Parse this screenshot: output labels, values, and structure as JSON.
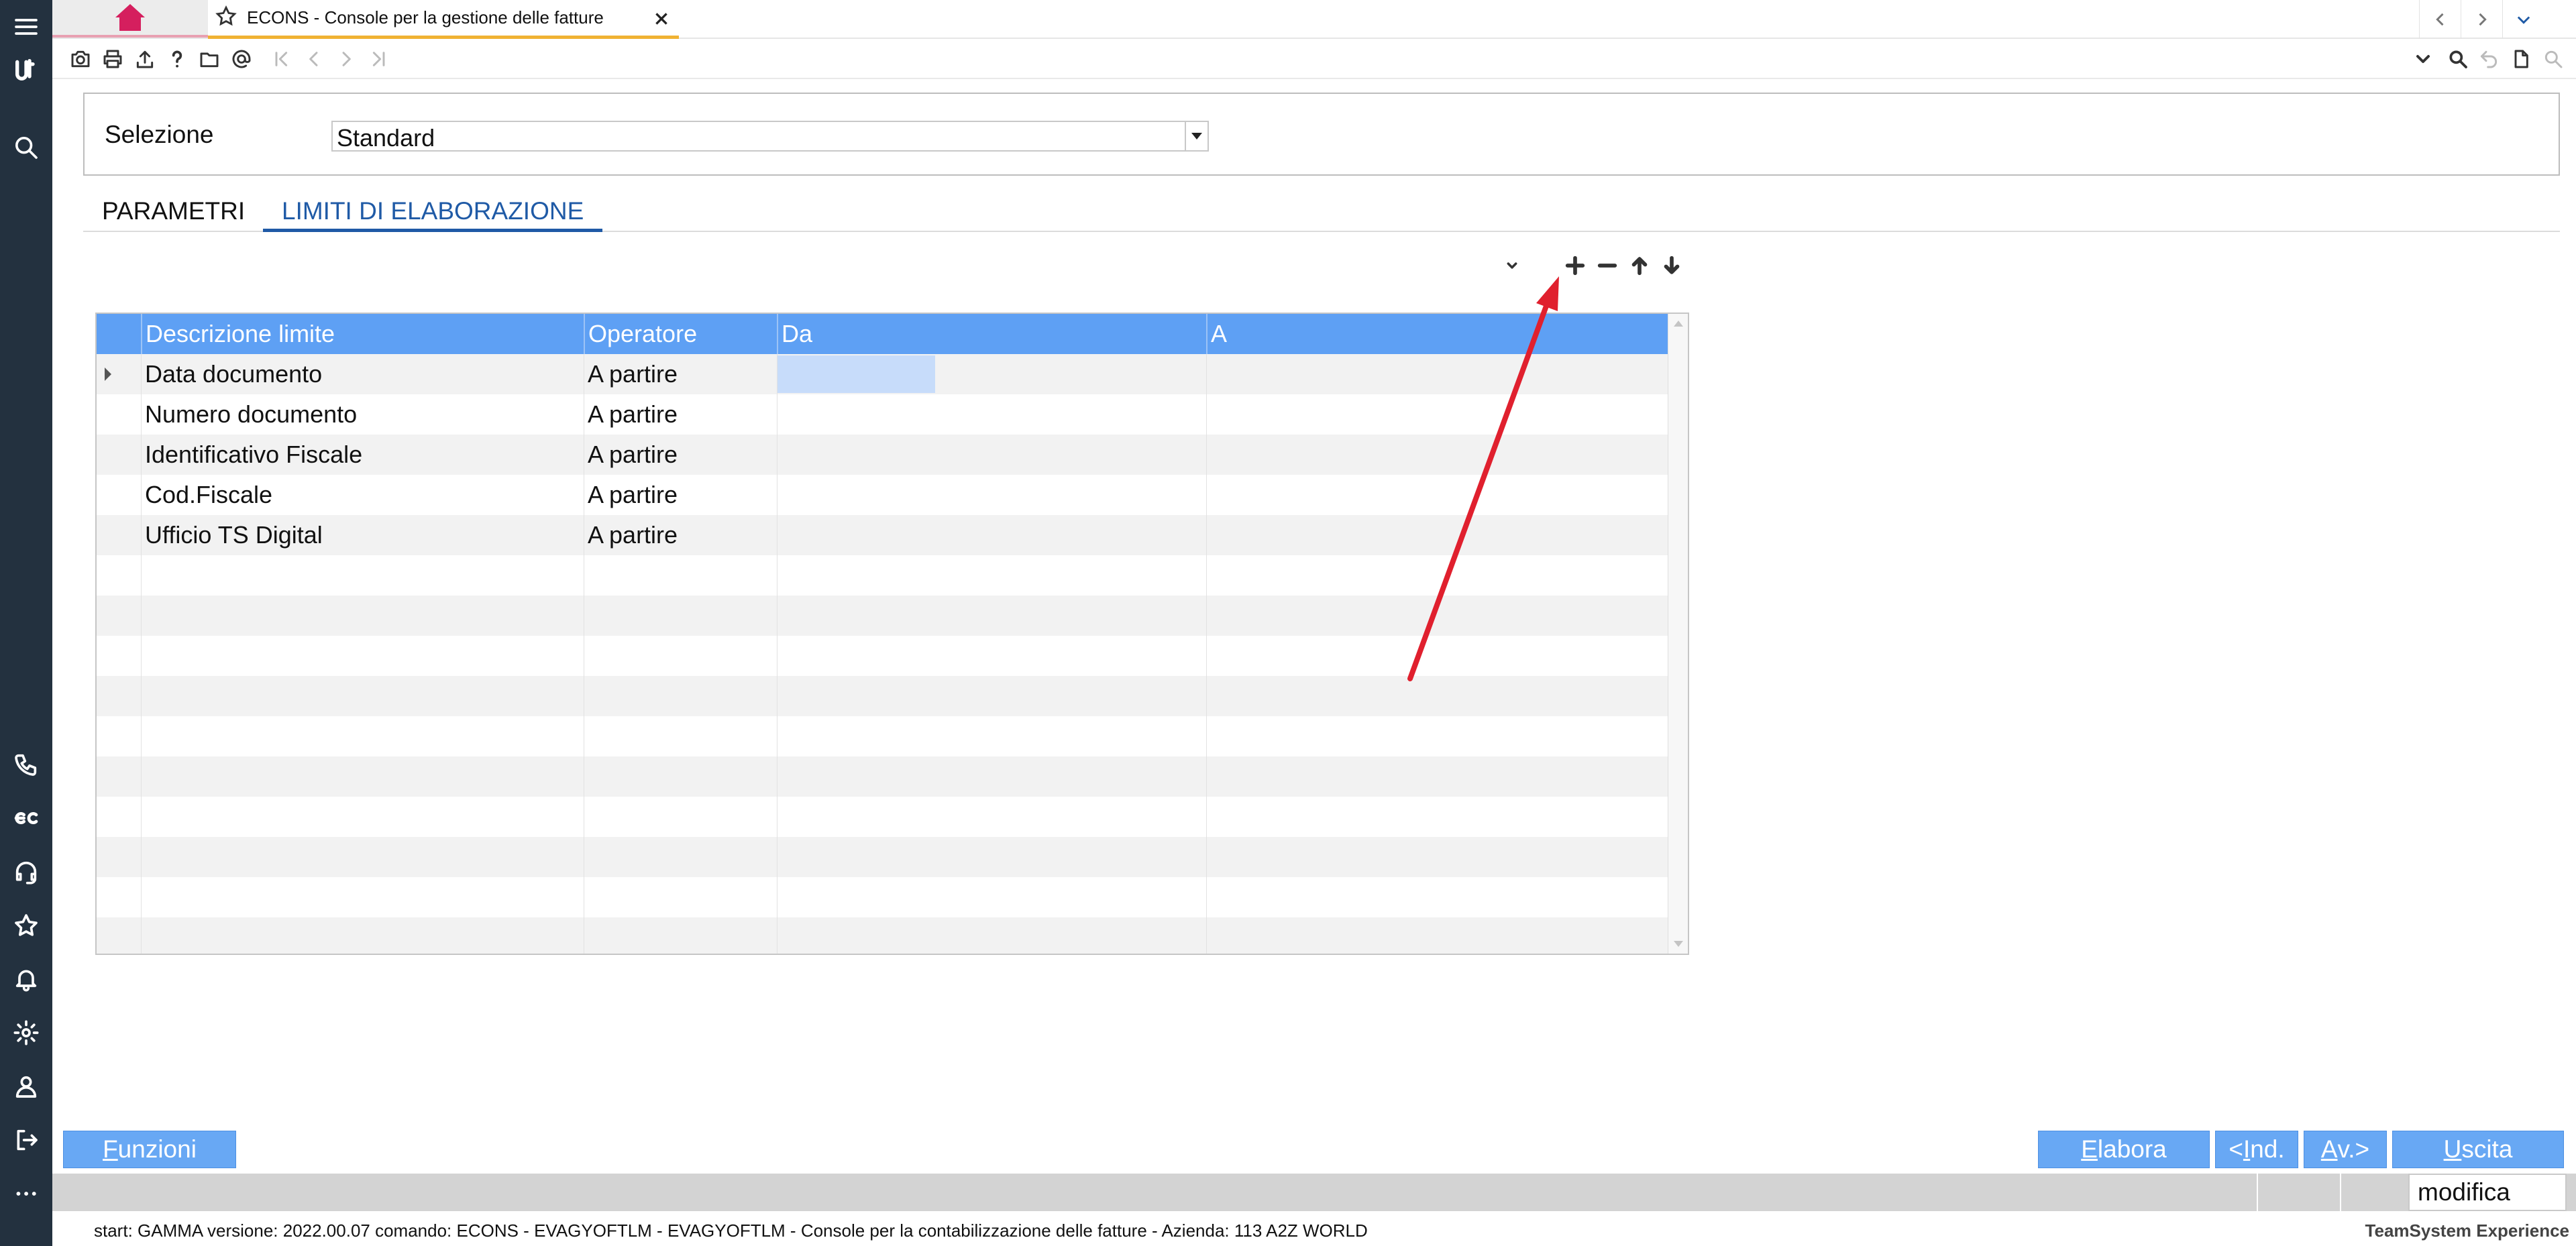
{
  "tab": {
    "title": "ECONS - Console per la gestione delle fatture"
  },
  "selezione": {
    "label": "Selezione",
    "value": "Standard"
  },
  "tabs": [
    {
      "label": "PARAMETRI",
      "active": false
    },
    {
      "label": "LIMITI DI ELABORAZIONE",
      "active": true
    }
  ],
  "grid": {
    "headers": [
      "Descrizione limite",
      "Operatore",
      "Da",
      "A"
    ],
    "rows": [
      {
        "descrizione": "Data documento",
        "operatore": "A partire",
        "da": "",
        "a": ""
      },
      {
        "descrizione": "Numero documento",
        "operatore": "A partire",
        "da": "",
        "a": ""
      },
      {
        "descrizione": "Identificativo Fiscale",
        "operatore": "A partire",
        "da": "",
        "a": ""
      },
      {
        "descrizione": "Cod.Fiscale",
        "operatore": "A partire",
        "da": "",
        "a": ""
      },
      {
        "descrizione": "Ufficio TS Digital",
        "operatore": "A partire",
        "da": "",
        "a": ""
      }
    ],
    "empty_rows": 10
  },
  "buttons": {
    "funzioni": {
      "key": "F",
      "rest": "unzioni"
    },
    "elabora": {
      "key": "E",
      "rest": "labora"
    },
    "indietro": {
      "pre": "<",
      "key": "I",
      "rest": "nd."
    },
    "avanti": {
      "key": "A",
      "rest": "v.>"
    },
    "uscita": {
      "key": "U",
      "rest": "scita"
    }
  },
  "status": {
    "mode": "modifica"
  },
  "footer": {
    "text": "start: GAMMA versione: 2022.00.07 comando: ECONS - EVAGYOFTLM - EVAGYOFTLM - Console per la contabilizzazione delle fatture - Azienda: 113 A2Z WORLD",
    "brand": "TeamSystem Experience"
  },
  "colors": {
    "sidebar": "#23313f",
    "grid_header": "#5ea0f4",
    "button": "#68a8f4",
    "active_tab": "#1f5aa6",
    "home_icon": "#d51f5e",
    "tab_underline": "#f0b233",
    "annotation": "#e0202e"
  },
  "icons": {
    "sidebar_top": [
      "menu-icon",
      "teamsystem-logo-icon",
      "search-icon"
    ],
    "sidebar_bottom": [
      "phone-icon",
      "ec-logo-icon",
      "headset-icon",
      "star-icon",
      "bell-icon",
      "gear-icon",
      "user-icon",
      "logout-icon",
      "more-icon"
    ],
    "toolbar": [
      "camera-icon",
      "print-icon",
      "upload-icon",
      "help-icon",
      "folder-icon",
      "at-icon",
      "first-icon",
      "prev-icon",
      "next-icon",
      "last-icon"
    ],
    "grid_toolbar": [
      "chevron-down-icon",
      "plus-icon",
      "minus-icon",
      "arrow-up-icon",
      "arrow-down-icon"
    ]
  }
}
